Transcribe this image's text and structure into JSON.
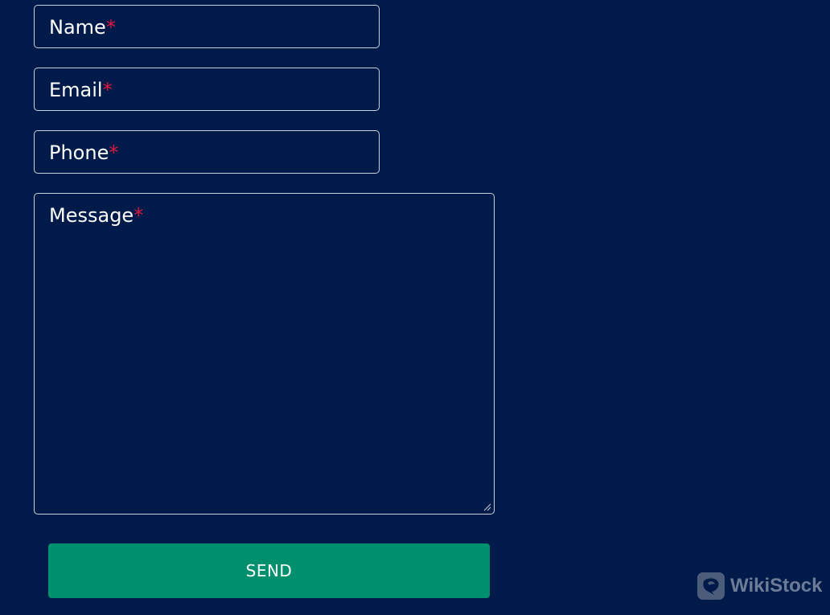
{
  "form": {
    "name": {
      "label": "Name",
      "required_mark": "*"
    },
    "email": {
      "label": "Email",
      "required_mark": "*"
    },
    "phone": {
      "label": "Phone",
      "required_mark": "*"
    },
    "message": {
      "label": "Message",
      "required_mark": "*"
    },
    "send_label": "SEND"
  },
  "watermark": {
    "text": "WikiStock"
  },
  "colors": {
    "background": "#001b49",
    "field_border": "#c9d1de",
    "required": "#e2173e",
    "button": "#00906e",
    "text": "#ffffff"
  }
}
